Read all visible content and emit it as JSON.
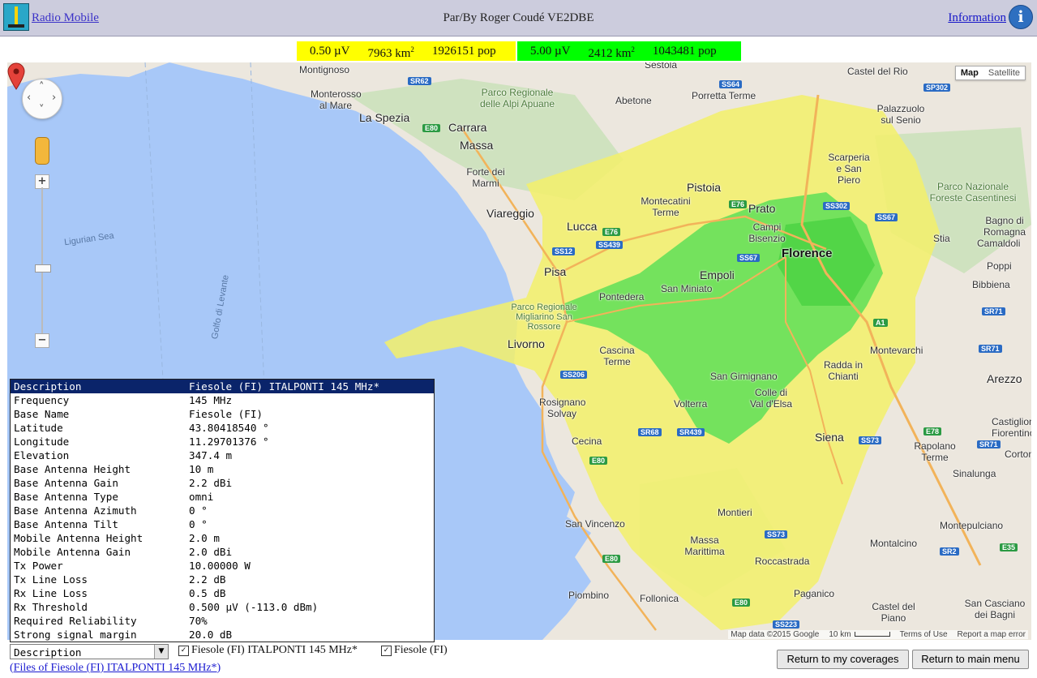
{
  "header": {
    "app_link": "Radio Mobile",
    "author": "Par/By Roger Coudé VE2DBE",
    "info_link": "Information",
    "info_icon": "info-icon"
  },
  "legend": {
    "low": {
      "field": "0.50 µV",
      "area": "7963 km",
      "area_sup": "2",
      "pop": "1926151 pop",
      "color": "#ffff00"
    },
    "high": {
      "field": "5.00 µV",
      "area": "2412 km",
      "area_sup": "2",
      "pop": "1043481 pop",
      "color": "#00ff00"
    }
  },
  "map": {
    "type_buttons": [
      "Map",
      "Satellite"
    ],
    "active_type": "Map",
    "footer": {
      "data": "Map data ©2015 Google",
      "scale": "10 km",
      "terms": "Terms of Use",
      "report": "Report a map error"
    },
    "marker_color": "#e4423a",
    "places": [
      {
        "n": "Castel del Rio",
        "c": "place"
      },
      {
        "n": "Sestola",
        "c": "place"
      },
      {
        "n": "Montignoso",
        "c": "place"
      },
      {
        "n": "Porretta Terme",
        "c": "place"
      },
      {
        "n": "Monterosso al Mare",
        "c": "place"
      },
      {
        "n": "Parco Regionale delle Alpi Apuane",
        "c": "place"
      },
      {
        "n": "Abetone",
        "c": "place"
      },
      {
        "n": "Palazzuolo sul Senio",
        "c": "place"
      },
      {
        "n": "La Spezia",
        "c": "big"
      },
      {
        "n": "Carrara",
        "c": "big"
      },
      {
        "n": "Massa",
        "c": "big"
      },
      {
        "n": "Forte dei Marmi",
        "c": "place"
      },
      {
        "n": "Scarperia e San Piero",
        "c": "place"
      },
      {
        "n": "Parco Nazionale Foreste Casentinesi",
        "c": "place"
      },
      {
        "n": "Pistoia",
        "c": "big"
      },
      {
        "n": "Montecatini Terme",
        "c": "place"
      },
      {
        "n": "Prato",
        "c": "big"
      },
      {
        "n": "Viareggio",
        "c": "big"
      },
      {
        "n": "Campi Bisenzio",
        "c": "place"
      },
      {
        "n": "Lucca",
        "c": "big"
      },
      {
        "n": "Bagno di Romagna",
        "c": "place"
      },
      {
        "n": "Stia",
        "c": "place"
      },
      {
        "n": "Camaldoli",
        "c": "place"
      },
      {
        "n": "Florence",
        "c": "city"
      },
      {
        "n": "Poppi",
        "c": "place"
      },
      {
        "n": "Bibbiena",
        "c": "place"
      },
      {
        "n": "Pisa",
        "c": "big"
      },
      {
        "n": "Empoli",
        "c": "big"
      },
      {
        "n": "San Miniato",
        "c": "place"
      },
      {
        "n": "Pontedera",
        "c": "place"
      },
      {
        "n": "Parco Regionale Migliarino San Rossore",
        "c": "place"
      },
      {
        "n": "Livorno",
        "c": "big"
      },
      {
        "n": "Montevarchi",
        "c": "place"
      },
      {
        "n": "Cascina Terme",
        "c": "place"
      },
      {
        "n": "Radda in Chianti",
        "c": "place"
      },
      {
        "n": "San Gimignano",
        "c": "place"
      },
      {
        "n": "Arezzo",
        "c": "big"
      },
      {
        "n": "Rosignano Solvay",
        "c": "place"
      },
      {
        "n": "Volterra",
        "c": "place"
      },
      {
        "n": "Colle di Val d'Elsa",
        "c": "place"
      },
      {
        "n": "Castiglion Fiorentino",
        "c": "place"
      },
      {
        "n": "Siena",
        "c": "big"
      },
      {
        "n": "Cecina",
        "c": "place"
      },
      {
        "n": "Rapolano Terme",
        "c": "place"
      },
      {
        "n": "Corton",
        "c": "place"
      },
      {
        "n": "Sinalunga",
        "c": "place"
      },
      {
        "n": "Montieri",
        "c": "place"
      },
      {
        "n": "San Vincenzo",
        "c": "place"
      },
      {
        "n": "Montepulciano",
        "c": "place"
      },
      {
        "n": "Massa Marittima",
        "c": "place"
      },
      {
        "n": "Roccastrada",
        "c": "place"
      },
      {
        "n": "Montalcino",
        "c": "place"
      },
      {
        "n": "Piombino",
        "c": "place"
      },
      {
        "n": "Follonica",
        "c": "place"
      },
      {
        "n": "Paganico",
        "c": "place"
      },
      {
        "n": "Castel del Piano",
        "c": "place"
      },
      {
        "n": "San Casciano dei Bagni",
        "c": "place"
      }
    ],
    "sea_labels": [
      "Ligurian Sea",
      "Golfo di Levante"
    ],
    "roads": [
      {
        "n": "SR62",
        "g": false
      },
      {
        "n": "SS64",
        "g": false
      },
      {
        "n": "SP302",
        "g": false
      },
      {
        "n": "E80",
        "g": false
      },
      {
        "n": "E76",
        "g": true
      },
      {
        "n": "SS302",
        "g": false
      },
      {
        "n": "SS67",
        "g": false
      },
      {
        "n": "E76",
        "g": true
      },
      {
        "n": "SS439",
        "g": false
      },
      {
        "n": "SS12",
        "g": false
      },
      {
        "n": "SS67",
        "g": false
      },
      {
        "n": "SR71",
        "g": false
      },
      {
        "n": "A1",
        "g": true
      },
      {
        "n": "SR71",
        "g": false
      },
      {
        "n": "SS206",
        "g": false
      },
      {
        "n": "E78",
        "g": true
      },
      {
        "n": "SR68",
        "g": false
      },
      {
        "n": "SR439",
        "g": false
      },
      {
        "n": "SS73",
        "g": false
      },
      {
        "n": "SR71",
        "g": false
      },
      {
        "n": "E80",
        "g": true
      },
      {
        "n": "SS73",
        "g": false
      },
      {
        "n": "E35",
        "g": true
      },
      {
        "n": "E80",
        "g": true
      },
      {
        "n": "E80",
        "g": true
      },
      {
        "n": "SS223",
        "g": false
      },
      {
        "n": "SR2",
        "g": false
      }
    ]
  },
  "parameters": [
    {
      "k": "Description",
      "v": "Fiesole (FI) ITALPONTI 145 MHz*"
    },
    {
      "k": "Frequency",
      "v": "145 MHz"
    },
    {
      "k": "Base Name",
      "v": "Fiesole (FI)"
    },
    {
      "k": "Latitude",
      "v": "43.80418540 °"
    },
    {
      "k": "Longitude",
      "v": "11.29701376 °"
    },
    {
      "k": "Elevation",
      "v": "347.4 m"
    },
    {
      "k": "Base Antenna Height",
      "v": "10 m"
    },
    {
      "k": "Base Antenna Gain",
      "v": "2.2 dBi"
    },
    {
      "k": "Base Antenna Type",
      "v": "omni"
    },
    {
      "k": "Base Antenna Azimuth",
      "v": "0 °"
    },
    {
      "k": "Base Antenna Tilt",
      "v": "0 °"
    },
    {
      "k": "Mobile Antenna Height",
      "v": "2.0 m"
    },
    {
      "k": "Mobile Antenna Gain",
      "v": "2.0 dBi"
    },
    {
      "k": "Tx Power",
      "v": "10.00000 W"
    },
    {
      "k": "Tx Line Loss",
      "v": "2.2 dB"
    },
    {
      "k": "Rx Line Loss",
      "v": "0.5 dB"
    },
    {
      "k": "Rx Threshold",
      "v": "0.500 µV (-113.0 dBm)"
    },
    {
      "k": "Required Reliability",
      "v": "70%"
    },
    {
      "k": "Strong signal margin",
      "v": "20.0 dB"
    }
  ],
  "controls": {
    "select_value": "Description",
    "checkbox1": "Fiesole (FI) ITALPONTI 145 MHz*",
    "checkbox2": "Fiesole (FI)",
    "btn_return_coverages": "Return to my coverages",
    "btn_return_main": "Return to main menu",
    "files_link": "Files of Fiesole (FI) ITALPONTI 145 MHz*"
  }
}
